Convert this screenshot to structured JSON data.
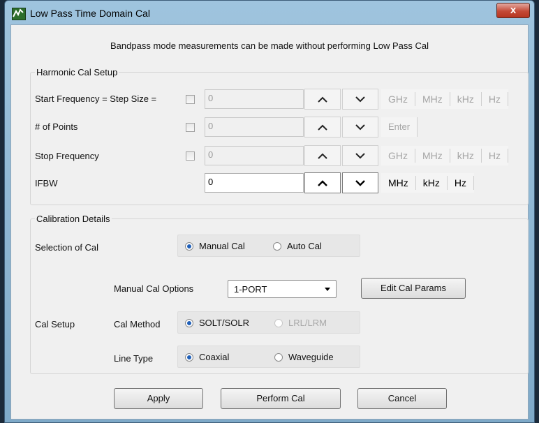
{
  "window": {
    "title": "Low Pass Time Domain Cal",
    "close_label": "x"
  },
  "notice": "Bandpass mode measurements can be made without performing Low Pass Cal",
  "harmonic": {
    "legend": "Harmonic Cal Setup",
    "start": {
      "label": "Start Frequency = Step Size =",
      "value": "0",
      "units": [
        "GHz",
        "MHz",
        "kHz",
        "Hz"
      ]
    },
    "points": {
      "label": "# of Points",
      "value": "0",
      "enter_label": "Enter"
    },
    "stop": {
      "label": "Stop Frequency",
      "value": "0",
      "units": [
        "GHz",
        "MHz",
        "kHz",
        "Hz"
      ]
    },
    "ifbw": {
      "label": "IFBW",
      "value": "0",
      "units": [
        "MHz",
        "kHz",
        "Hz"
      ]
    }
  },
  "calibration": {
    "legend": "Calibration Details",
    "selection_label": "Selection of Cal",
    "selection_options": [
      "Manual Cal",
      "Auto Cal"
    ],
    "cal_setup_label": "Cal Setup",
    "manual_options_label": "Manual Cal Options",
    "manual_options_value": "1-PORT",
    "edit_params_label": "Edit Cal Params",
    "method_label": "Cal Method",
    "method_options": [
      "SOLT/SOLR",
      "LRL/LRM"
    ],
    "line_type_label": "Line Type",
    "line_type_options": [
      "Coaxial",
      "Waveguide"
    ]
  },
  "buttons": {
    "apply": "Apply",
    "perform": "Perform Cal",
    "cancel": "Cancel"
  }
}
